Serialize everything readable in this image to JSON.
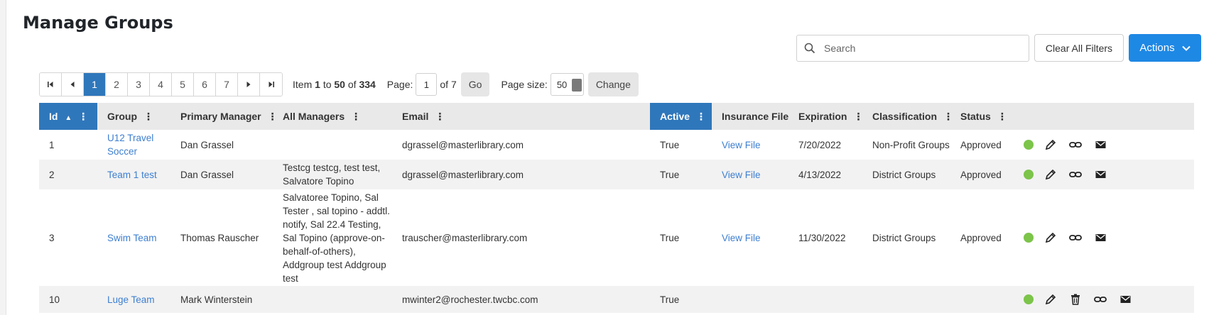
{
  "page": {
    "title": "Manage Groups"
  },
  "toolbar": {
    "search_placeholder": "Search",
    "clear_label": "Clear All Filters",
    "actions_label": "Actions"
  },
  "pager": {
    "pages": [
      "1",
      "2",
      "3",
      "4",
      "5",
      "6",
      "7"
    ],
    "current_page": "1",
    "item_prefix": "Item",
    "item_from": "1",
    "item_to_word": "to",
    "item_to": "50",
    "item_of_word": "of",
    "item_total": "334",
    "page_label": "Page:",
    "page_value": "1",
    "page_of": "of 7",
    "go_label": "Go",
    "size_label": "Page size:",
    "size_value": "50",
    "change_label": "Change"
  },
  "columns": {
    "id": "Id",
    "group": "Group",
    "primary_manager": "Primary Manager",
    "all_managers": "All Managers",
    "email": "Email",
    "active": "Active",
    "insurance": "Insurance File",
    "expiration": "Expiration",
    "classification": "Classification",
    "status": "Status"
  },
  "rows": [
    {
      "id": "1",
      "group": "U12 Travel Soccer",
      "primary_manager": "Dan Grassel",
      "all_managers": "",
      "email": "dgrassel@masterlibrary.com",
      "active": "True",
      "insurance": "View File",
      "expiration": "7/20/2022",
      "classification": "Non-Profit Groups",
      "status": "Approved"
    },
    {
      "id": "2",
      "group": "Team 1 test",
      "primary_manager": "Dan Grassel",
      "all_managers": "Testcg testcg, test test, Salvatore Topino",
      "email": "dgrassel@masterlibrary.com",
      "active": "True",
      "insurance": "View File",
      "expiration": "4/13/2022",
      "classification": "District Groups",
      "status": "Approved"
    },
    {
      "id": "3",
      "group": "Swim Team",
      "primary_manager": "Thomas Rauscher",
      "all_managers": "Salvatoree Topino, Sal Tester , sal topino - addtl. notify, Sal 22.4 Testing, Sal Topino (approve-on-behalf-of-others), Addgroup test Addgroup test",
      "email": "trauscher@masterlibrary.com",
      "active": "True",
      "insurance": "View File",
      "expiration": "11/30/2022",
      "classification": "District Groups",
      "status": "Approved"
    },
    {
      "id": "10",
      "group": "Luge Team",
      "primary_manager": "Mark Winterstein",
      "all_managers": "",
      "email": "mwinter2@rochester.twcbc.com",
      "active": "True",
      "insurance": "",
      "expiration": "",
      "classification": "",
      "status": ""
    }
  ],
  "colors": {
    "accent": "#1e88e5",
    "header_sorted": "#2f77bb",
    "link": "#3d7fd0",
    "expired": "#e02020",
    "active_dot": "#7cc44a"
  },
  "icons": {
    "row_actions": [
      "status-dot",
      "edit-pencil-icon",
      "link-icon",
      "email-icon"
    ],
    "row_actions_last": [
      "status-dot",
      "edit-pencil-icon",
      "trash-icon",
      "link-icon",
      "email-icon"
    ]
  }
}
